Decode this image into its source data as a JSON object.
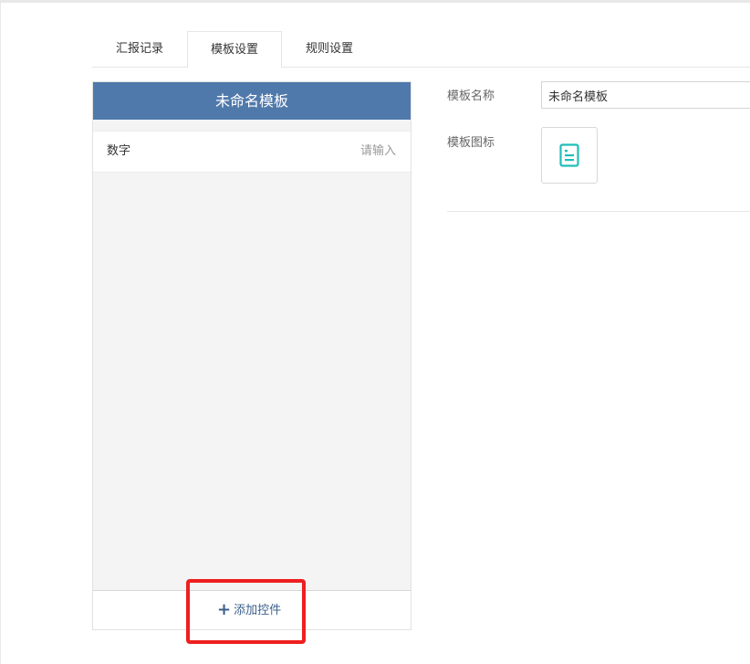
{
  "tabs": [
    {
      "label": "汇报记录",
      "active": false
    },
    {
      "label": "模板设置",
      "active": true
    },
    {
      "label": "规则设置",
      "active": false
    }
  ],
  "preview": {
    "title": "未命名模板",
    "field": {
      "label": "数字",
      "placeholder": "请输入"
    },
    "add_button_label": "添加控件",
    "add_button_icon": "plus-icon"
  },
  "form": {
    "name_label": "模板名称",
    "name_value": "未命名模板",
    "icon_label": "模板图标",
    "icon": "document-icon",
    "icon_color": "#1fbfb8"
  },
  "colors": {
    "header_bg": "#5079ab",
    "highlight": "#ee1f1f",
    "add_button_text": "#3d5f8c"
  }
}
